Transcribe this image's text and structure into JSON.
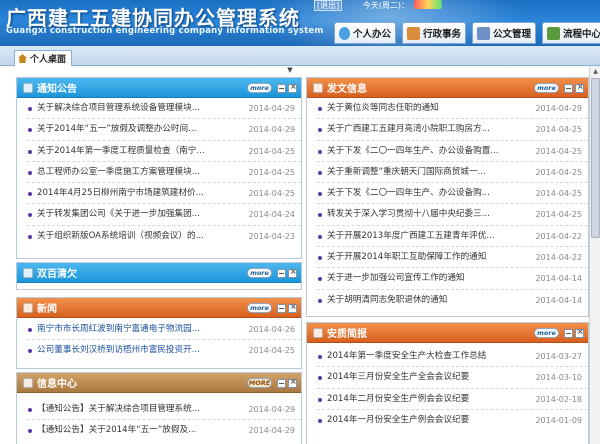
{
  "header": {
    "title": "广西建工五建协同办公管理系统",
    "subtitle": "Guangxi construction engineering company information system",
    "exit_label": "[退出]",
    "date_text": "今天(周二)："
  },
  "nav": [
    {
      "label": "个人办公",
      "icon": "person-icon"
    },
    {
      "label": "行政事务",
      "icon": "briefcase-icon"
    },
    {
      "label": "公文管理",
      "icon": "document-icon"
    },
    {
      "label": "流程中心",
      "icon": "workflow-icon"
    }
  ],
  "tabs": {
    "active": "个人桌面"
  },
  "colors": {
    "header": "#1b6fc4",
    "blue_panel": "#1a95d9",
    "orange_panel": "#d8601f",
    "brown_panel": "#a8783e",
    "bullet": "#5b3aa6"
  },
  "panels": {
    "notice": {
      "title": "通知公告",
      "more": "more",
      "items": [
        {
          "title": "关于解决综合项目管理系统设备管理模块...",
          "date": "2014-04-29"
        },
        {
          "title": "关于2014年“五一”放假及调整办公时间...",
          "date": "2014-04-29"
        },
        {
          "title": "关于2014年第一季度工程质量检查（南宁...",
          "date": "2014-04-25"
        },
        {
          "title": "总工程师办公室一季度施工方案管理模块...",
          "date": "2014-04-25"
        },
        {
          "title": "2014年4月25日柳州南宁市场建筑建材价...",
          "date": "2014-04-25"
        },
        {
          "title": "关于转发集团公司《关于进一步加强集团...",
          "date": "2014-04-24"
        },
        {
          "title": "关于组织新版OA系统培训（视频会议）的...",
          "date": "2014-04-23"
        }
      ]
    },
    "double_hundred": {
      "title": "双百清欠",
      "more": "more"
    },
    "news": {
      "title": "新闻",
      "more": "more",
      "items": [
        {
          "title": "南宁市市长周红波到南宁富通电子物流园...",
          "date": "2014-04-26"
        },
        {
          "title": "公司董事长刘汉桥到访梧州市富民投资开...",
          "date": "2014-04-25"
        }
      ]
    },
    "info_center": {
      "title": "信息中心",
      "more": "MORE",
      "items": [
        {
          "title": "【通知公告】关于解决综合项目管理系统...",
          "date": "2014-04-29"
        },
        {
          "title": "【通知公告】关于2014年“五一”放假及...",
          "date": "2014-04-29"
        }
      ]
    },
    "dispatch": {
      "title": "发文信息",
      "more": "more",
      "items": [
        {
          "title": "关于黄位炎等同志任职的通知",
          "date": "2014-04-29"
        },
        {
          "title": "关于广西建工五建月亮湾小院职工购房方...",
          "date": "2014-04-25"
        },
        {
          "title": "关于下发《二〇一四年生产、办公设备购置...",
          "date": "2014-04-25"
        },
        {
          "title": "关于重新调整“重庆朝天门国际商贸城一...",
          "date": "2014-04-25"
        },
        {
          "title": "关于下发《二〇一四年生产、办公设备购...",
          "date": "2014-04-25"
        },
        {
          "title": "转发关于深入学习贯彻十八届中央纪委三...",
          "date": "2014-04-25"
        },
        {
          "title": "关于开展2013年度广西建工五建青年评优...",
          "date": "2014-04-22"
        },
        {
          "title": "关于开展2014年职工互助保障工作的通知",
          "date": "2014-04-22"
        },
        {
          "title": "关于进一步加强公司宣传工作的通知",
          "date": "2014-04-14"
        },
        {
          "title": "关于胡明清同志免职退休的通知",
          "date": "2014-04-14"
        }
      ]
    },
    "safety": {
      "title": "安质简报",
      "more": "more",
      "items": [
        {
          "title": "2014年第一季度安全生产大检查工作总结",
          "date": "2014-03-27"
        },
        {
          "title": "2014年三月份安全生产全会会议纪要",
          "date": "2014-03-10"
        },
        {
          "title": "2014年二月份安全生产例会会议纪要",
          "date": "2014-02-18"
        },
        {
          "title": "2014年一月份安全生产例会会议纪要",
          "date": "2014-01-09"
        }
      ]
    }
  }
}
